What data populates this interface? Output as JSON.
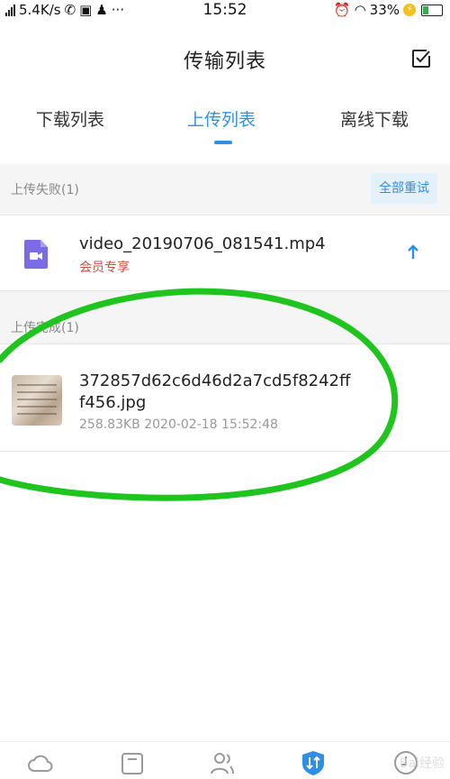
{
  "status_bar": {
    "network_speed": "5.4K/s",
    "time": "15:52",
    "battery": "33%"
  },
  "header": {
    "title": "传输列表"
  },
  "tabs": [
    {
      "label": "下载列表",
      "active": false
    },
    {
      "label": "上传列表",
      "active": true
    },
    {
      "label": "离线下载",
      "active": false
    }
  ],
  "failed_section": {
    "label": "上传失败(1)",
    "retry_all": "全部重试",
    "items": [
      {
        "name": "video_20190706_081541.mp4",
        "note": "会员专享"
      }
    ]
  },
  "done_section": {
    "label": "上传完成(1)",
    "items": [
      {
        "name_line1": "372857d62c6d46d2a7cd5f8242ff",
        "name_line2": "f456.jpg",
        "meta": "258.83KB 2020-02-18 15:52:48"
      }
    ]
  },
  "bottom_nav": [
    "cloud-icon",
    "folder-icon",
    "contacts-icon",
    "transfer-icon",
    "profile-icon"
  ],
  "watermark": "Bai经验",
  "colors": {
    "accent": "#2f8fe5",
    "annotation": "#1fc41f"
  }
}
